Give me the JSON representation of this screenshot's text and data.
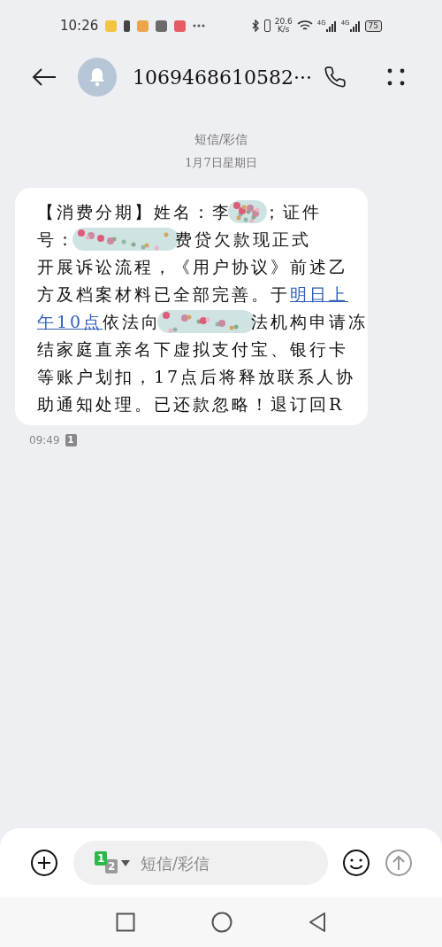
{
  "status_bar": {
    "time": "10:26",
    "net_speed": [
      "20.6",
      "K/s"
    ],
    "signal_labels": [
      "4G",
      "4G"
    ],
    "battery": "75"
  },
  "header": {
    "title": "1069468610582···"
  },
  "thread": {
    "channel": "短信/彩信",
    "date": "1月7日星期日",
    "lines": [
      [
        {
          "kind": "text",
          "text": "【消费分期】姓名：李"
        },
        {
          "kind": "redacted"
        },
        {
          "kind": "text",
          "text": "；证件"
        }
      ],
      [
        {
          "kind": "text",
          "text": "号："
        },
        {
          "kind": "redacted"
        },
        {
          "kind": "text",
          "text": "费贷欠款现正式"
        }
      ],
      [
        {
          "kind": "text",
          "text": "开展诉讼流程，《用户协议》前述乙"
        }
      ],
      [
        {
          "kind": "text",
          "text": "方及档案材料已全部完善。于"
        },
        {
          "kind": "link",
          "text": "明日上"
        }
      ],
      [
        {
          "kind": "link",
          "text": "午10点"
        },
        {
          "kind": "text",
          "text": "依法向"
        },
        {
          "kind": "redacted"
        },
        {
          "kind": "text",
          "text": "法机构申请冻"
        }
      ],
      [
        {
          "kind": "text",
          "text": "结家庭直亲名下虚拟支付宝、银行卡"
        }
      ],
      [
        {
          "kind": "text",
          "text": "等账户划扣，17点后将释放联系人协"
        }
      ],
      [
        {
          "kind": "text",
          "text": "助通知处理。已还款忽略！退订回R"
        }
      ]
    ],
    "time": "09:49",
    "sim": "1"
  },
  "composer": {
    "sims": [
      {
        "label": "1",
        "selected": true
      },
      {
        "label": "2",
        "selected": false
      }
    ],
    "placeholder": "短信/彩信"
  }
}
